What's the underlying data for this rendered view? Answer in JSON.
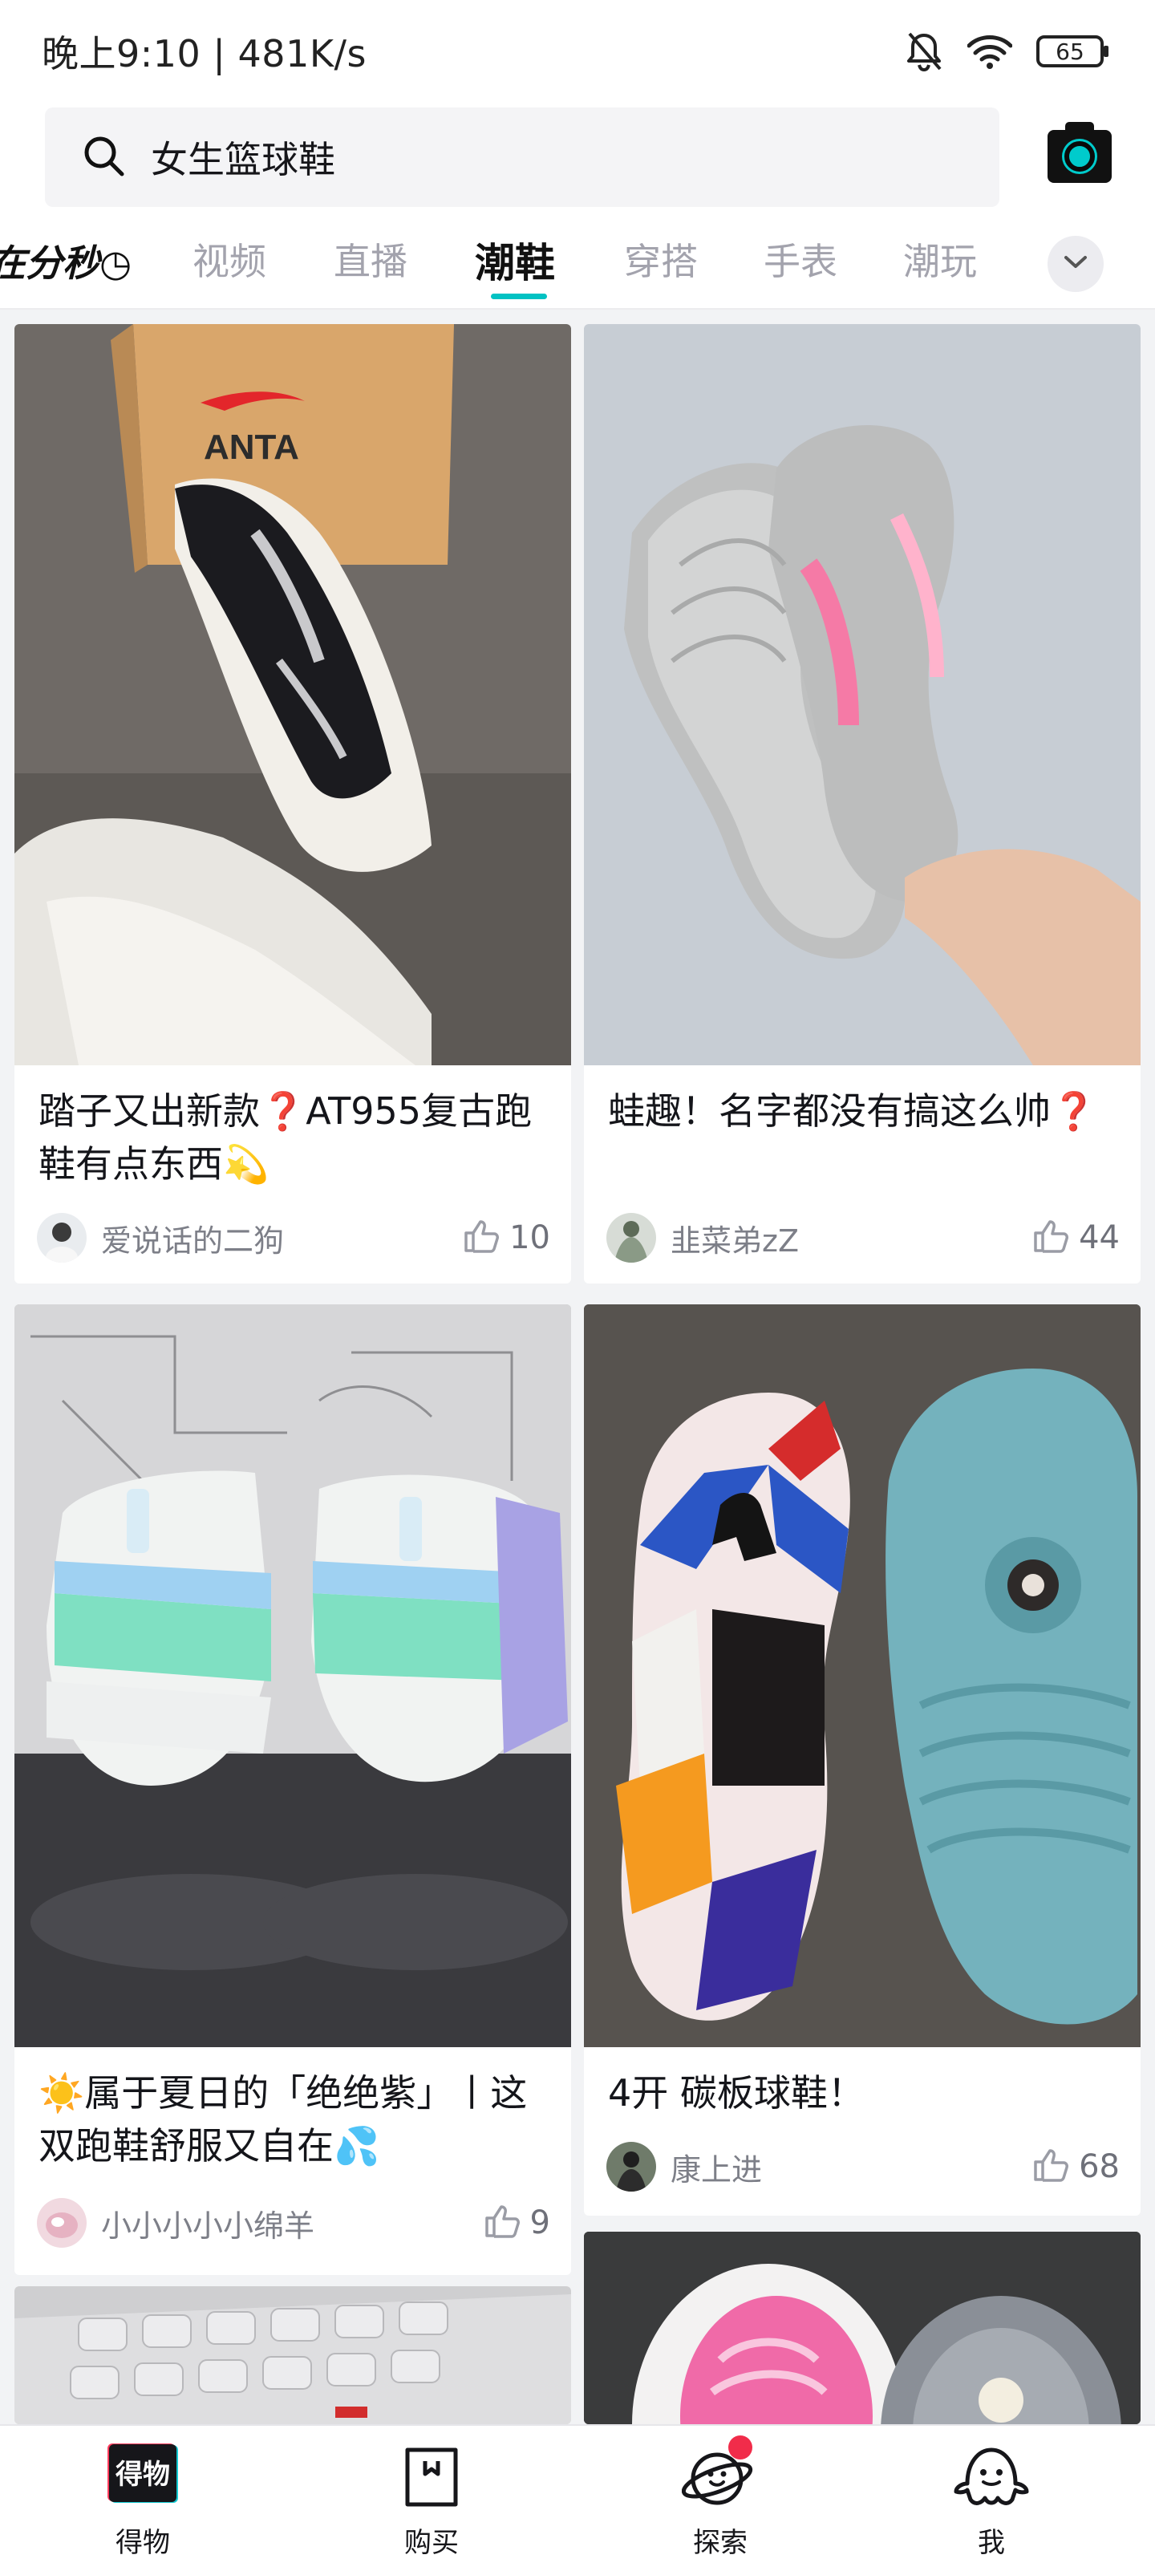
{
  "status_bar": {
    "text": "晚上9:10 | 481K/s",
    "battery": "65"
  },
  "search": {
    "query": "女生篮球鞋"
  },
  "tabs": [
    {
      "label": "在分秒◷",
      "active": false
    },
    {
      "label": "视频",
      "active": false
    },
    {
      "label": "直播",
      "active": false
    },
    {
      "label": "潮鞋",
      "active": true
    },
    {
      "label": "穿搭",
      "active": false
    },
    {
      "label": "手表",
      "active": false
    },
    {
      "label": "潮玩",
      "active": false
    }
  ],
  "accent_color": "#01c2c3",
  "feed": [
    {
      "title": "踏子又出新款❓AT955复古跑鞋有点东西💫",
      "author": "爱说话的二狗",
      "likes": "10",
      "image": "anta-box-shoe-sole"
    },
    {
      "title": "蛙趣！名字都没有搞这么帅❓",
      "author": "韭菜弟zZ",
      "likes": "44",
      "image": "grey-soles-held-in-hand"
    },
    {
      "title": "☀️属于夏日的「绝绝紫」丨这双跑鞋舒服又自在💦",
      "author": "小小小小小绵羊",
      "likes": "9",
      "image": "purple-green-running-shoes"
    },
    {
      "title": "4开 碳板球鞋！",
      "author": "康上进",
      "likes": "68",
      "image": "jordan-and-blue-soles-on-fur"
    }
  ],
  "bottom_nav": [
    {
      "label": "得物",
      "icon": "dewu-logo-icon"
    },
    {
      "label": "购买",
      "icon": "shopping-bag-icon"
    },
    {
      "label": "探索",
      "icon": "planet-icon",
      "badge": true
    },
    {
      "label": "我",
      "icon": "ghost-avatar-icon"
    }
  ]
}
